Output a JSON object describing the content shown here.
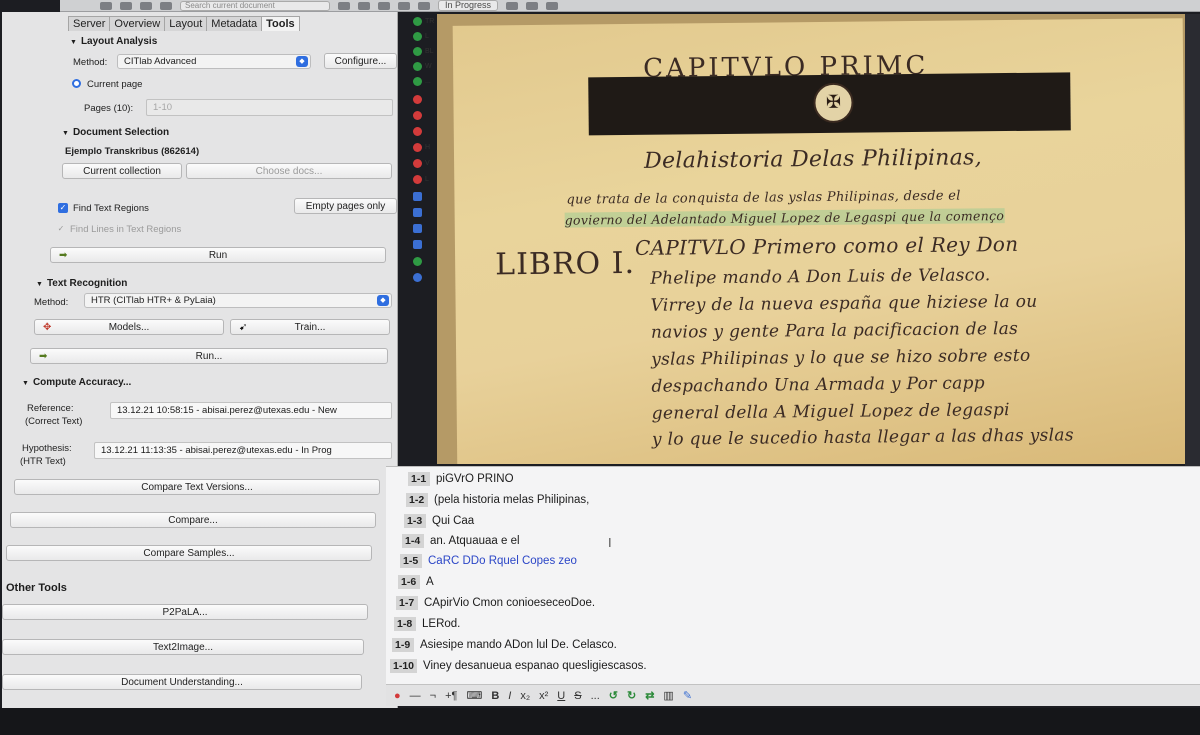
{
  "toolbar": {
    "search_placeholder": "Search current document",
    "status": "In Progress"
  },
  "left_panel": {
    "tabs": [
      "Server",
      "Overview",
      "Layout",
      "Metadata",
      "Tools"
    ],
    "layout_analysis": {
      "title": "Layout Analysis",
      "method_label": "Method:",
      "method_value": "CITlab Advanced",
      "configure_label": "Configure...",
      "current_page_label": "Current page",
      "pages_label": "Pages (10):",
      "pages_value": "1-10"
    },
    "document_selection": {
      "title": "Document Selection",
      "document": "Ejemplo Transkribus (862614)",
      "current_collection_label": "Current collection",
      "choose_docs_label": "Choose docs...",
      "find_text_regions_label": "Find Text Regions",
      "empty_pages_label": "Empty pages only",
      "find_lines_label": "Find Lines in Text Regions",
      "run_label": "Run"
    },
    "text_recognition": {
      "title": "Text Recognition",
      "method_label": "Method:",
      "method_value": "HTR (CITlab HTR+ & PyLaia)",
      "models_label": "Models...",
      "train_label": "Train...",
      "run_label": "Run..."
    },
    "compute_accuracy": {
      "title": "Compute Accuracy...",
      "reference_label": "Reference:",
      "reference_sublabel": "(Correct Text)",
      "reference_value": "13.12.21 10:58:15 - abisai.perez@utexas.edu - New",
      "hypothesis_label": "Hypothesis:",
      "hypothesis_sublabel": "(HTR Text)",
      "hypothesis_value": "13.12.21 11:13:35 - abisai.perez@utexas.edu - In Prog",
      "compare_text_versions_label": "Compare Text Versions...",
      "compare_label": "Compare...",
      "compare_samples_label": "Compare Samples..."
    },
    "other_tools": {
      "title": "Other Tools",
      "p2pala_label": "P2PaLA...",
      "text2image_label": "Text2Image...",
      "document_understanding_label": "Document Understanding..."
    }
  },
  "tool_strip": [
    "TR",
    "L",
    "BL",
    "W",
    "...",
    "",
    "",
    "",
    "H",
    "V",
    "L"
  ],
  "manuscript": {
    "heading": "CAPITVLO PRIMC",
    "subtitle": "Delahistoria Delas Philipinas,",
    "line1": "que trata de la conquista de las yslas Philipinas, desde el",
    "line2": "govierno del Adelantado Miguel Lopez de Legaspi que la començo",
    "libro": "LIBRO I.",
    "capitulo": "CAPITVLO Primero como el Rey Don",
    "body": [
      "Phelipe mando A Don Luis de Velasco.",
      "Virrey de la nueva españa que hiziese la ou",
      "navios y gente Para la pacificacion de las",
      "yslas Philipinas y lo que se hizo sobre esto",
      "despachando Una Armada y Por capp",
      "general della A Miguel Lopez de legaspi",
      "y lo que le sucedio hasta llegar a las dhas yslas"
    ]
  },
  "transcription": {
    "lines": [
      {
        "no": "1-1",
        "text": "piGVrO PRINO"
      },
      {
        "no": "1-2",
        "text": "(pela historia melas Philipinas,"
      },
      {
        "no": "1-3",
        "text": "Qui Caa"
      },
      {
        "no": "1-4",
        "text": "an. Atquauaa e el"
      },
      {
        "no": "1-5",
        "text": "CaRC DDo Rquel Copes zeo"
      },
      {
        "no": "1-6",
        "text": "A"
      },
      {
        "no": "1-7",
        "text": "CApirVio Cmon conioeseceoDoe."
      },
      {
        "no": "1-8",
        "text": "LERod."
      },
      {
        "no": "1-9",
        "text": "Asiesipe mando ADon lul De. Celasco."
      },
      {
        "no": "1-10",
        "text": "Viney desanueua espanao quesligiescasos."
      }
    ]
  },
  "format_toolbar": {
    "bold": "B",
    "italic": "I",
    "subscript": "x₂",
    "superscript": "x²",
    "underline": "U",
    "strike": "S",
    "more": "..."
  }
}
